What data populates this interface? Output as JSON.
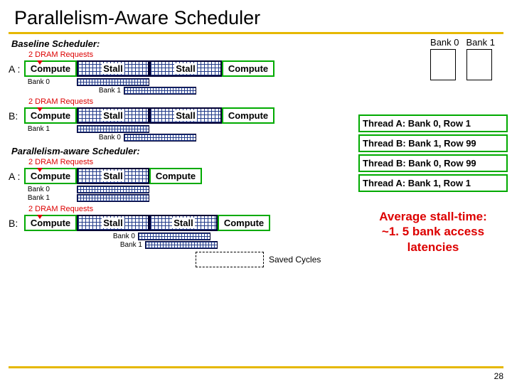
{
  "title": "Parallelism-Aware Scheduler",
  "baseline_label": "Baseline Scheduler:",
  "parallel_label": "Parallelism-aware Scheduler:",
  "req_label": "2 DRAM Requests",
  "labels": {
    "A": "A :",
    "B": "B:",
    "compute": "Compute",
    "stall": "Stall",
    "bank0": "Bank 0",
    "bank1": "Bank 1",
    "saved": "Saved Cycles"
  },
  "queue": [
    "Thread A: Bank 0, Row 1",
    "Thread B: Bank 1, Row 99",
    "Thread B: Bank 0, Row 99",
    "Thread A: Bank 1, Row 1"
  ],
  "avg_line1": "Average stall-time:",
  "avg_line2": "~1. 5 bank access",
  "avg_line3": "latencies",
  "slide": "28"
}
